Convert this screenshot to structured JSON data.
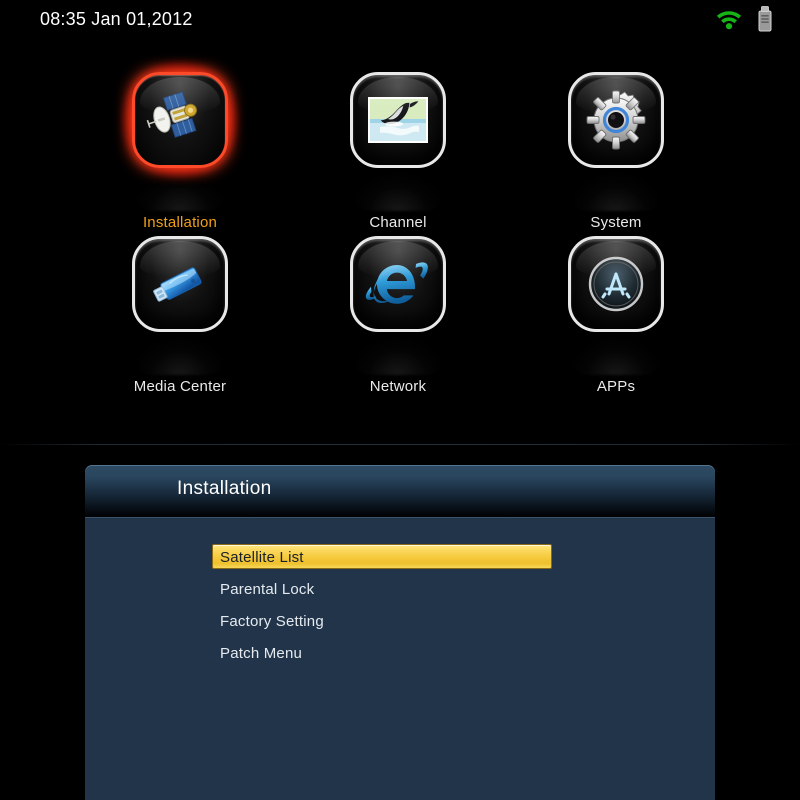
{
  "status_bar": {
    "clock": "08:35 Jan 01,2012",
    "icons": [
      {
        "name": "wifi-icon",
        "label": "WiFi Connected",
        "color": "#16b515"
      },
      {
        "name": "usb-drive-icon",
        "label": "USB Storage",
        "color": "#9a9a9a"
      }
    ]
  },
  "home": {
    "apps": [
      {
        "id": "installation",
        "label": "Installation",
        "icon": "satellite-icon",
        "selected": true
      },
      {
        "id": "channel",
        "label": "Channel",
        "icon": "orca-tv-icon",
        "selected": false
      },
      {
        "id": "system",
        "label": "System",
        "icon": "gear-icon",
        "selected": false
      },
      {
        "id": "media-center",
        "label": "Media Center",
        "icon": "usb-flash-drive-icon",
        "selected": false
      },
      {
        "id": "network",
        "label": "Network",
        "icon": "internet-explorer-icon",
        "selected": false
      },
      {
        "id": "apps",
        "label": "APPs",
        "icon": "app-store-icon",
        "selected": false
      }
    ],
    "selected_color": "#f0a018",
    "selection_ring_color": "#ff3c19"
  },
  "menu_panel": {
    "title": "Installation",
    "highlight_color": "#f5c93c",
    "panel_color": "#223449",
    "items": [
      {
        "label": "Satellite List",
        "highlighted": true
      },
      {
        "label": "Parental Lock",
        "highlighted": false
      },
      {
        "label": "Factory Setting",
        "highlighted": false
      },
      {
        "label": "Patch Menu",
        "highlighted": false
      }
    ]
  }
}
